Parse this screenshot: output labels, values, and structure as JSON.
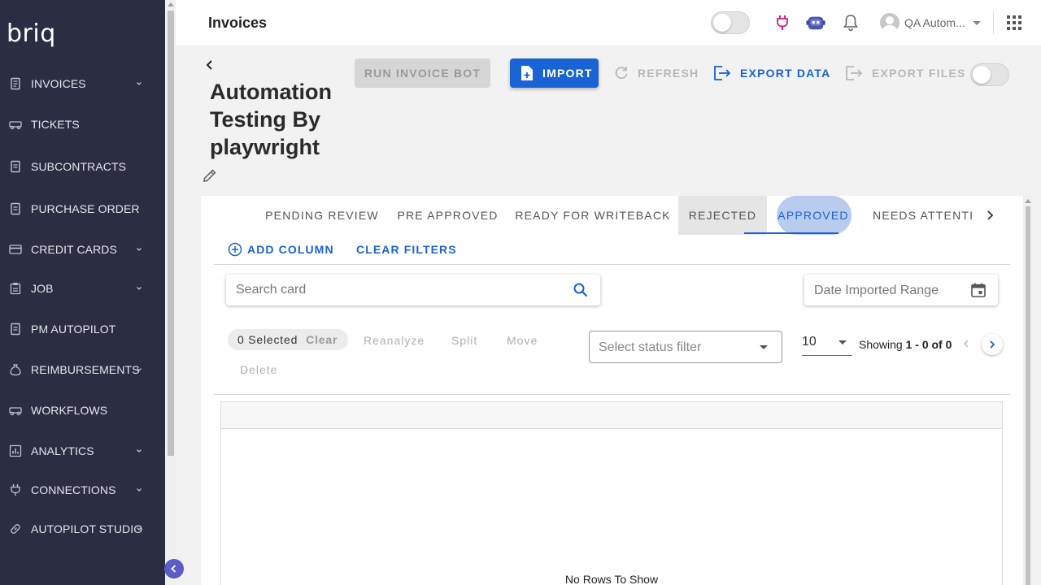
{
  "sidebar": {
    "logo": "briq",
    "items": [
      {
        "label": "INVOICES",
        "has_children": true
      },
      {
        "label": "TICKETS",
        "has_children": false
      },
      {
        "label": "SUBCONTRACTS",
        "has_children": false
      },
      {
        "label": "PURCHASE ORDER",
        "has_children": false
      },
      {
        "label": "CREDIT CARDS",
        "has_children": true
      },
      {
        "label": "JOB",
        "has_children": true
      },
      {
        "label": "PM AUTOPILOT",
        "has_children": false
      },
      {
        "label": "REIMBURSEMENTS",
        "has_children": true
      },
      {
        "label": "WORKFLOWS",
        "has_children": false
      },
      {
        "label": "ANALYTICS",
        "has_children": true
      },
      {
        "label": "CONNECTIONS",
        "has_children": true
      },
      {
        "label": "AUTOPILOT STUDIO",
        "has_children": true
      }
    ]
  },
  "header": {
    "title": "Invoices",
    "user_name": "QA Autom...",
    "icons": [
      "plug-icon",
      "bot-icon",
      "bell-icon",
      "apps-grid-icon"
    ]
  },
  "page": {
    "doc_title": "Automation Testing By playwright"
  },
  "toolbar": {
    "run_invoice_bot": "RUN INVOICE BOT",
    "import": "IMPORT",
    "refresh": "REFRESH",
    "export_data": "EXPORT DATA",
    "export_files": "EXPORT FILES"
  },
  "tabs": [
    {
      "label": "PENDING REVIEW"
    },
    {
      "label": "PRE APPROVED"
    },
    {
      "label": "READY FOR WRITEBACK"
    },
    {
      "label": "REJECTED"
    },
    {
      "label": "APPROVED",
      "active": true
    },
    {
      "label": "NEEDS ATTENTI"
    }
  ],
  "filters": {
    "add_column": "ADD COLUMN",
    "clear_filters": "CLEAR FILTERS",
    "search_placeholder": "Search card",
    "date_range_placeholder": "Date Imported Range",
    "status_placeholder": "Select status filter"
  },
  "selection": {
    "count": "0 Selected",
    "clear": "Clear",
    "actions": [
      "Reanalyze",
      "Split",
      "Move",
      "Delete"
    ]
  },
  "pagination": {
    "page_size": "10",
    "showing_prefix": "Showing ",
    "showing_range": "1 - 0 of 0"
  },
  "grid": {
    "empty_message": "No Rows To Show"
  },
  "colors": {
    "sidebar_bg": "#2b2d42",
    "primary": "#1a63d4",
    "plug_icon": "#d81b8a",
    "bot_icon": "#3f51b5"
  }
}
